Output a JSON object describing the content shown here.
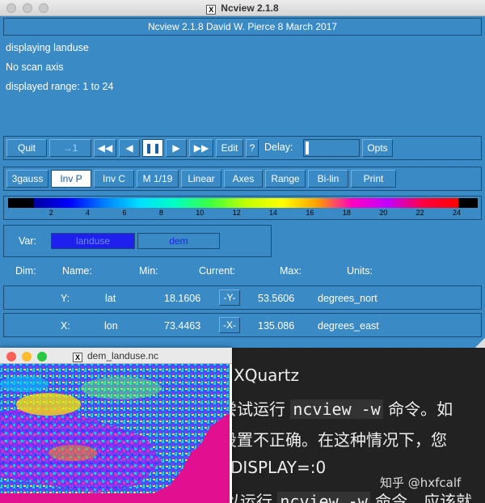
{
  "window": {
    "title": "Ncview 2.1.8"
  },
  "header": {
    "text": "Ncview 2.1.8 David W. Pierce  8 March 2017"
  },
  "info": {
    "line1": "displaying landuse",
    "line2": "No scan axis",
    "line3": "displayed range: 1 to 24"
  },
  "controls": {
    "quit": "Quit",
    "step": "→1",
    "rewind": "◀◀",
    "back": "◀",
    "pause": "❚❚",
    "forward": "▶",
    "fast_forward": "▶▶",
    "edit": "Edit",
    "help": "?",
    "delay_label": "Delay:",
    "opts": "Opts"
  },
  "options": {
    "b1": "3gauss",
    "b2": "Inv P",
    "b3": "Inv C",
    "b4": "M 1/19",
    "b5": "Linear",
    "b6": "Axes",
    "b7": "Range",
    "b8": "Bi-lin",
    "b9": "Print"
  },
  "colorbar": {
    "ticks": [
      "2",
      "4",
      "6",
      "8",
      "10",
      "12",
      "14",
      "16",
      "18",
      "20",
      "22",
      "24"
    ],
    "range": [
      1,
      24
    ]
  },
  "var": {
    "label": "Var:",
    "v1": "landuse",
    "v2": "dem"
  },
  "dims": {
    "headers": {
      "dim": "Dim:",
      "name": "Name:",
      "min": "Min:",
      "current": "Current:",
      "max": "Max:",
      "units": "Units:"
    },
    "y": {
      "dim": "Y:",
      "name": "lat",
      "min": "18.1606",
      "current": "-Y-",
      "max": "53.5606",
      "units": "degrees_nort"
    },
    "x": {
      "dim": "X:",
      "name": "lon",
      "min": "73.4463",
      "current": "-X-",
      "max": "135.086",
      "units": "degrees_east"
    }
  },
  "subwindow": {
    "title": "dem_landuse.nc"
  },
  "background_text": {
    "l1": "XQuartz",
    "l2a": "尝试运行 ",
    "l2b": "ncview -w",
    "l2c": " 命令。如",
    "l3": "设置不正确。在这种情况下，您",
    "l4": "DISPLAY=:0",
    "l5a": "您可以运行 ",
    "l5b": "ncview -w",
    "l5c": " 命令，应该就",
    "watermark": "知乎 @hxfcalf"
  }
}
